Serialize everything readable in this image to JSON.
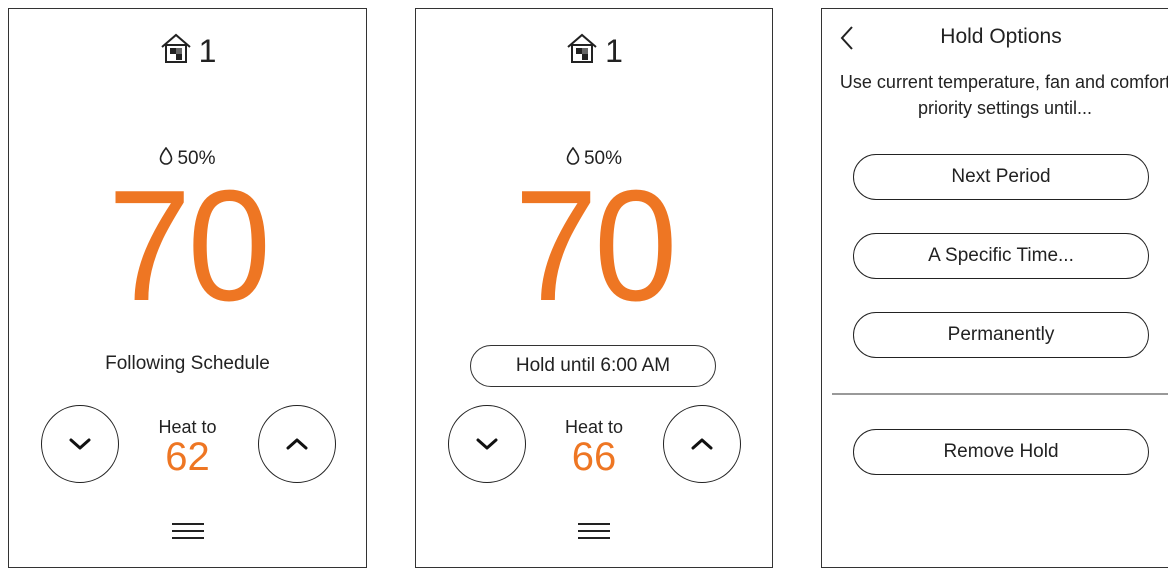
{
  "screens": [
    {
      "zone_number": "1",
      "humidity": "50%",
      "current_temp": "70",
      "status_text": "Following Schedule",
      "heat_label": "Heat to",
      "setpoint": "62"
    },
    {
      "zone_number": "1",
      "humidity": "50%",
      "current_temp": "70",
      "hold_button_label": "Hold until 6:00 AM",
      "heat_label": "Heat to",
      "setpoint": "66"
    },
    {
      "title": "Hold Options",
      "description": "Use current temperature, fan and comfort priority settings until...",
      "options": [
        "Next Period",
        "A Specific Time...",
        "Permanently"
      ],
      "remove_label": "Remove Hold"
    }
  ],
  "colors": {
    "accent": "#ee7623",
    "text": "#222222",
    "divider": "#999999"
  },
  "icons": [
    "home-zone-icon",
    "humidity-drop-icon",
    "chevron-down-icon",
    "chevron-up-icon",
    "menu-icon",
    "back-arrow-icon"
  ]
}
